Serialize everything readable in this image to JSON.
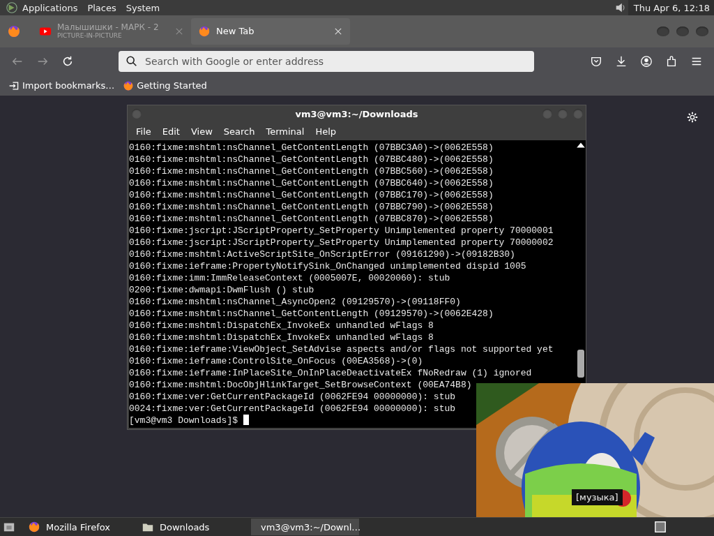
{
  "top_panel": {
    "menus": [
      "Applications",
      "Places",
      "System"
    ],
    "clock": "Thu Apr  6, 12:18"
  },
  "browser": {
    "tabs": [
      {
        "kind": "youtube",
        "title": "Малышишки - МАРК - 2",
        "subtitle": "PICTURE-IN-PICTURE",
        "selected": false
      },
      {
        "kind": "firefox",
        "title": "New Tab",
        "selected": true
      }
    ],
    "address": {
      "placeholder": "Search with Google or enter address"
    },
    "bookmarks": [
      {
        "kind": "import",
        "label": "Import bookmarks…"
      },
      {
        "kind": "firefox",
        "label": "Getting Started"
      }
    ]
  },
  "terminal": {
    "title": "vm3@vm3:~/Downloads",
    "menus": [
      "File",
      "Edit",
      "View",
      "Search",
      "Terminal",
      "Help"
    ],
    "lines": [
      "0160:fixme:mshtml:nsChannel_GetContentLength (07BBC3A0)->(0062E558)",
      "0160:fixme:mshtml:nsChannel_GetContentLength (07BBC480)->(0062E558)",
      "0160:fixme:mshtml:nsChannel_GetContentLength (07BBC560)->(0062E558)",
      "0160:fixme:mshtml:nsChannel_GetContentLength (07BBC640)->(0062E558)",
      "0160:fixme:mshtml:nsChannel_GetContentLength (07BBC170)->(0062E558)",
      "0160:fixme:mshtml:nsChannel_GetContentLength (07BBC790)->(0062E558)",
      "0160:fixme:mshtml:nsChannel_GetContentLength (07BBC870)->(0062E558)",
      "0160:fixme:jscript:JScriptProperty_SetProperty Unimplemented property 70000001",
      "0160:fixme:jscript:JScriptProperty_SetProperty Unimplemented property 70000002",
      "0160:fixme:mshtml:ActiveScriptSite_OnScriptError (09161290)->(09182B30)",
      "0160:fixme:ieframe:PropertyNotifySink_OnChanged unimplemented dispid 1005",
      "0160:fixme:imm:ImmReleaseContext (0005007E, 00020060): stub",
      "0200:fixme:dwmapi:DwmFlush () stub",
      "0160:fixme:mshtml:nsChannel_AsyncOpen2 (09129570)->(09118FF0)",
      "0160:fixme:mshtml:nsChannel_GetContentLength (09129570)->(0062E428)",
      "0160:fixme:mshtml:DispatchEx_InvokeEx unhandled wFlags 8",
      "0160:fixme:mshtml:DispatchEx_InvokeEx unhandled wFlags 8",
      "0160:fixme:ieframe:ViewObject_SetAdvise aspects and/or flags not supported yet",
      "0160:fixme:ieframe:ControlSite_OnFocus (00EA3568)->(0)",
      "0160:fixme:ieframe:InPlaceSite_OnInPlaceDeactivateEx fNoRedraw (1) ignored",
      "0160:fixme:mshtml:DocObjHlinkTarget_SetBrowseContext (00EA74B8)",
      "0160:fixme:ver:GetCurrentPackageId (0062FE94 00000000): stub",
      "0024:fixme:ver:GetCurrentPackageId (0062FE94 00000000): stub"
    ],
    "prompt": "[vm3@vm3 Downloads]$"
  },
  "video": {
    "kind": "picture",
    "caption": "[музыка]"
  },
  "taskbar": {
    "items": [
      {
        "kind": "firefox",
        "label": "Mozilla Firefox",
        "selected": false
      },
      {
        "kind": "folder",
        "label": "Downloads",
        "selected": false
      },
      {
        "kind": "terminal",
        "label": "vm3@vm3:~/Downl…",
        "selected": true
      }
    ]
  }
}
